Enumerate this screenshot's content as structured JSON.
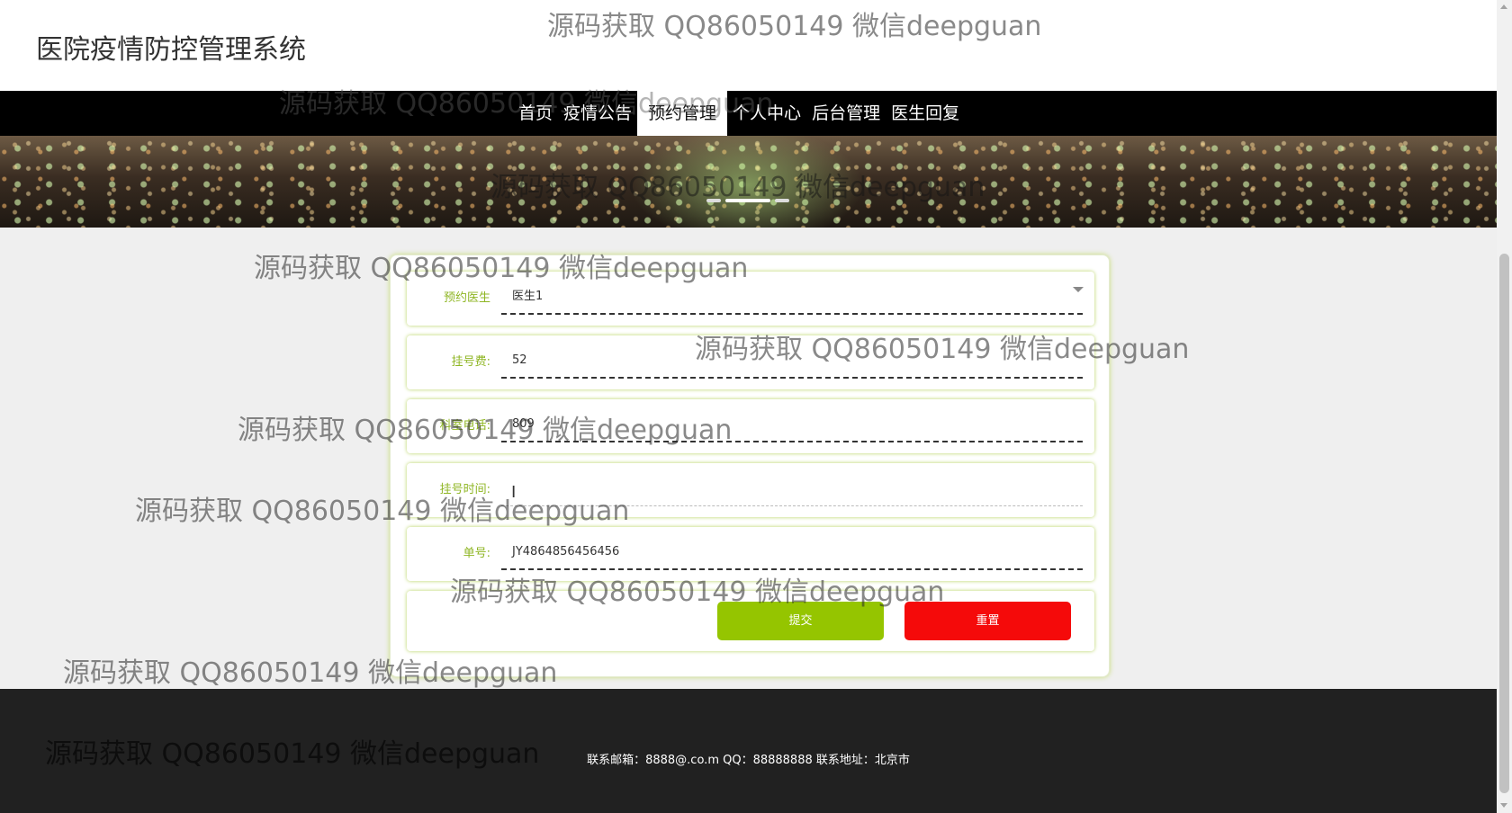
{
  "header": {
    "site_title": "医院疫情防控管理系统"
  },
  "nav": {
    "items": [
      {
        "label": "首页"
      },
      {
        "label": "疫情公告"
      },
      {
        "label": "预约管理"
      },
      {
        "label": "个人中心"
      },
      {
        "label": "后台管理"
      },
      {
        "label": "医生回复"
      }
    ],
    "active": "预约管理"
  },
  "banner": {
    "slides": 3,
    "active_slide": 2
  },
  "form": {
    "fields": [
      {
        "label": "预约医生",
        "value": "医生1",
        "type": "select"
      },
      {
        "label": "挂号费:",
        "value": "52",
        "type": "text"
      },
      {
        "label": "科室电话:",
        "value": "809",
        "type": "text"
      },
      {
        "label": "挂号时间:",
        "value": "",
        "type": "text"
      },
      {
        "label": "单号:",
        "value": "JY4864856456456",
        "type": "text"
      }
    ],
    "submit_label": "提交",
    "reset_label": "重置"
  },
  "footer": {
    "text": "联系邮箱：8888@.co.m QQ：88888888 联系地址：北京市"
  },
  "watermark": {
    "text": "源码获取 QQ86050149 微信deepguan"
  },
  "colors": {
    "accent_green": "#95c500",
    "label_green": "#8fb624",
    "reset_red": "#f50a0a",
    "nav_bg": "#000000",
    "footer_bg": "#212121"
  }
}
